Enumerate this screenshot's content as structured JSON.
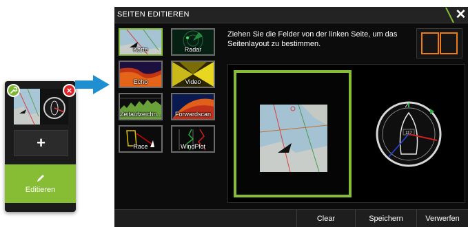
{
  "mini_panel": {
    "wrench_icon": "wrench-icon",
    "close_icon": "close-icon",
    "add_label": "+",
    "edit_label": "Editieren"
  },
  "dialog": {
    "title": "SEITEN EDITIEREN",
    "close_label": "✕",
    "instruction": "Ziehen Sie die Felder von der linken Seite, um das Seitenlayout zu bestimmen.",
    "tiles": [
      {
        "label": "Karte",
        "icon": "chart-icon",
        "selected": true
      },
      {
        "label": "Radar",
        "icon": "radar-icon",
        "selected": false
      },
      {
        "label": "Echo",
        "icon": "echo-icon",
        "selected": false
      },
      {
        "label": "Video",
        "icon": "video-icon",
        "selected": false
      },
      {
        "label": "Zeitaufzeichn...",
        "icon": "time-plot-icon",
        "selected": false
      },
      {
        "label": "Forwardscan",
        "icon": "forwardscan-icon",
        "selected": false
      },
      {
        "label": "Race",
        "icon": "race-icon",
        "selected": false
      },
      {
        "label": "WindPlot",
        "icon": "windplot-icon",
        "selected": false
      }
    ],
    "buttons": {
      "clear": "Clear",
      "save": "Speichern",
      "discard": "Verwerfen"
    },
    "compass_label": "117"
  },
  "colors": {
    "accent_green": "#86bd34",
    "layout_orange": "#ee7c16",
    "close_red": "#e3242b",
    "arrow_blue": "#1e8fd0"
  }
}
